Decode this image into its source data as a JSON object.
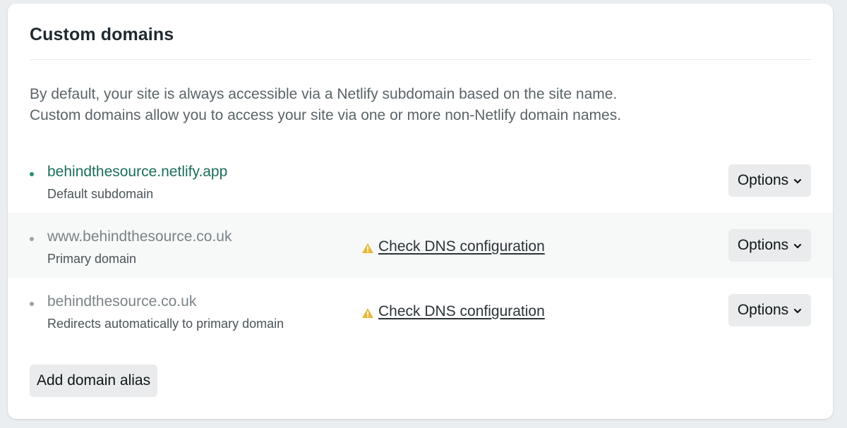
{
  "section": {
    "title": "Custom domains",
    "intro_line_1": "By default, your site is always accessible via a Netlify subdomain based on the site name.",
    "intro_line_2": "Custom domains allow you to access your site via one or more non-Netlify domain names."
  },
  "domains": [
    {
      "name": "behindthesource.netlify.app",
      "description": "Default subdomain",
      "options_label": "Options",
      "name_color": "#1b6e5c",
      "bullet_color": "#2a8f74"
    },
    {
      "name": "www.behindthesource.co.uk",
      "description": "Primary domain",
      "dns_warning": "Check DNS configuration",
      "options_label": "Options",
      "name_color": "#7a8387",
      "bullet_color": "#9aa2a6"
    },
    {
      "name": "behindthesource.co.uk",
      "description": "Redirects automatically to primary domain",
      "dns_warning": "Check DNS configuration",
      "options_label": "Options",
      "name_color": "#7a8387",
      "bullet_color": "#9aa2a6"
    }
  ],
  "actions": {
    "add_alias_label": "Add domain alias"
  },
  "icons": {
    "warning": "warning-triangle-icon",
    "chevron": "chevron-down-icon"
  },
  "colors": {
    "warning": "#e8b83a",
    "link_green": "#1b6e5c"
  }
}
